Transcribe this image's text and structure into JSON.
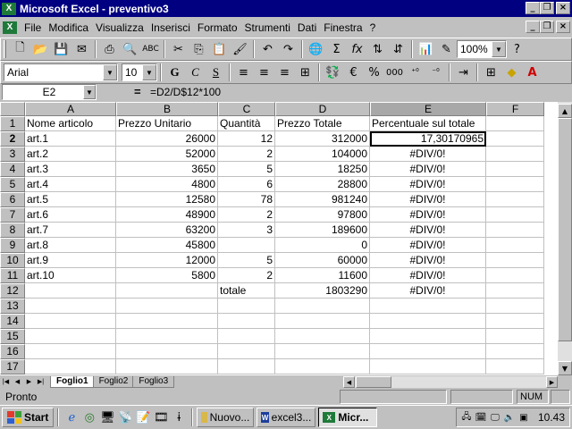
{
  "titlebar": {
    "title": "Microsoft Excel - preventivo3",
    "app_icon": "X"
  },
  "menus": [
    {
      "label": "File"
    },
    {
      "label": "Modifica"
    },
    {
      "label": "Visualizza"
    },
    {
      "label": "Inserisci"
    },
    {
      "label": "Formato"
    },
    {
      "label": "Strumenti"
    },
    {
      "label": "Dati"
    },
    {
      "label": "Finestra"
    },
    {
      "label": "?"
    }
  ],
  "toolbar": {
    "zoom": "100%",
    "font": "Arial",
    "font_size": "10",
    "bold": "G",
    "italic": "C",
    "underline": "S",
    "euro": "€",
    "percent": "%",
    "thousands": "000"
  },
  "formula_bar": {
    "cell_ref": "E2",
    "equals": "=",
    "formula": "=D2/D$12*100"
  },
  "columns": [
    "A",
    "B",
    "C",
    "D",
    "E",
    "F"
  ],
  "active_column": "E",
  "active_row": 2,
  "rows": [
    {
      "n": "1",
      "A": "Nome articolo",
      "B": "Prezzo Unitario",
      "C": "Quantità",
      "D": "Prezzo Totale",
      "E": "Percentuale sul totale",
      "F": ""
    },
    {
      "n": "2",
      "A": "art.1",
      "B": "26000",
      "C": "12",
      "D": "312000",
      "E": "17,30170965",
      "F": ""
    },
    {
      "n": "3",
      "A": "art.2",
      "B": "52000",
      "C": "2",
      "D": "104000",
      "E": "#DIV/0!",
      "F": ""
    },
    {
      "n": "4",
      "A": "art.3",
      "B": "3650",
      "C": "5",
      "D": "18250",
      "E": "#DIV/0!",
      "F": ""
    },
    {
      "n": "5",
      "A": "art.4",
      "B": "4800",
      "C": "6",
      "D": "28800",
      "E": "#DIV/0!",
      "F": ""
    },
    {
      "n": "6",
      "A": "art.5",
      "B": "12580",
      "C": "78",
      "D": "981240",
      "E": "#DIV/0!",
      "F": ""
    },
    {
      "n": "7",
      "A": "art.6",
      "B": "48900",
      "C": "2",
      "D": "97800",
      "E": "#DIV/0!",
      "F": ""
    },
    {
      "n": "8",
      "A": "art.7",
      "B": "63200",
      "C": "3",
      "D": "189600",
      "E": "#DIV/0!",
      "F": ""
    },
    {
      "n": "9",
      "A": "art.8",
      "B": "45800",
      "C": "",
      "D": "0",
      "E": "#DIV/0!",
      "F": ""
    },
    {
      "n": "10",
      "A": "art.9",
      "B": "12000",
      "C": "5",
      "D": "60000",
      "E": "#DIV/0!",
      "F": ""
    },
    {
      "n": "11",
      "A": "art.10",
      "B": "5800",
      "C": "2",
      "D": "11600",
      "E": "#DIV/0!",
      "F": ""
    },
    {
      "n": "12",
      "A": "",
      "B": "",
      "C": "totale",
      "D": "1803290",
      "E": "#DIV/0!",
      "F": ""
    },
    {
      "n": "13",
      "A": "",
      "B": "",
      "C": "",
      "D": "",
      "E": "",
      "F": ""
    },
    {
      "n": "14",
      "A": "",
      "B": "",
      "C": "",
      "D": "",
      "E": "",
      "F": ""
    },
    {
      "n": "15",
      "A": "",
      "B": "",
      "C": "",
      "D": "",
      "E": "",
      "F": ""
    },
    {
      "n": "16",
      "A": "",
      "B": "",
      "C": "",
      "D": "",
      "E": "",
      "F": ""
    },
    {
      "n": "17",
      "A": "",
      "B": "",
      "C": "",
      "D": "",
      "E": "",
      "F": ""
    }
  ],
  "sheet_tabs": [
    {
      "label": "Foglio1",
      "active": true
    },
    {
      "label": "Foglio2",
      "active": false
    },
    {
      "label": "Foglio3",
      "active": false
    }
  ],
  "status": {
    "text": "Pronto",
    "num": "NUM"
  },
  "taskbar": {
    "start": "Start",
    "buttons": [
      {
        "label": "Nuovo...",
        "icon": "folder",
        "active": false
      },
      {
        "label": "excel3...",
        "icon": "word",
        "active": false
      },
      {
        "label": "Micr...",
        "icon": "excel",
        "active": true
      }
    ],
    "clock": "10.43"
  }
}
